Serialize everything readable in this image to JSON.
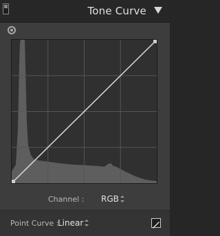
{
  "panel": {
    "title": "Tone Curve"
  },
  "channel": {
    "label": "Channel :",
    "value": "RGB"
  },
  "point_curve": {
    "label": "Point Curve :",
    "value": "Linear"
  },
  "icons": [
    "panel-toggle-icon",
    "collapse-triangle-icon",
    "targeted-adjustment-icon",
    "stepper-icon",
    "edit-point-curve-icon"
  ]
}
